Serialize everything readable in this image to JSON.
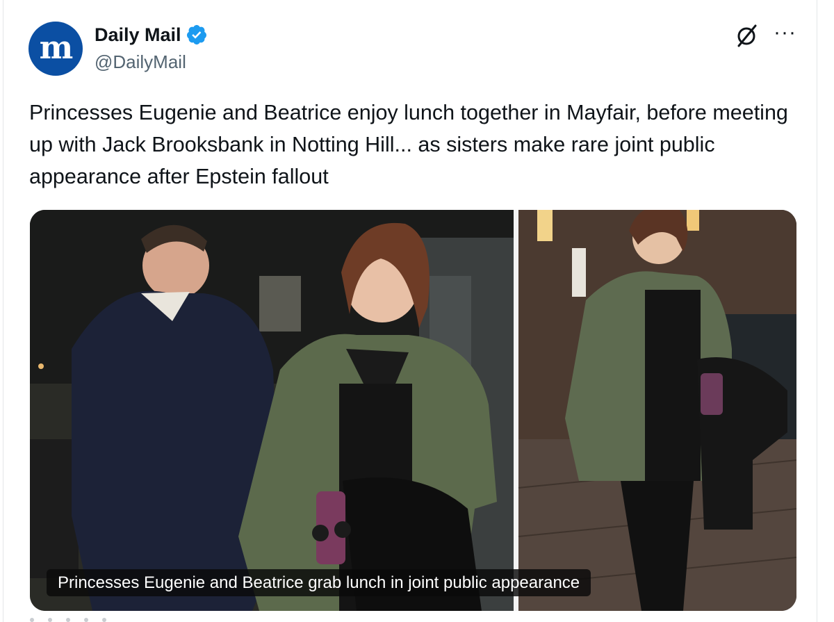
{
  "tweet": {
    "avatar": {
      "icon": "daily-mail-logo",
      "glyph": "m",
      "color": "#0b4fa3"
    },
    "author_name": "Daily Mail",
    "verified_icon": "verified-badge-icon",
    "verified_color": "#1d9bf0",
    "handle": "@DailyMail",
    "actions": {
      "grok_icon": "grok-icon",
      "more_icon": "more-options-icon",
      "more_glyph": "···"
    },
    "text": "Princesses Eugenie and Beatrice enjoy lunch together in Mayfair, before meeting up with Jack Brooksbank in Notting Hill... as sisters make rare joint public appearance after Epstein fallout",
    "media": {
      "photo_count": 2,
      "photos": [
        {
          "name": "photo-night-street",
          "subject": "two-people-walking"
        },
        {
          "name": "photo-restaurant-entrance",
          "subject": "woman-walking"
        }
      ],
      "caption": "Princesses Eugenie and Beatrice grab lunch in joint public appearance"
    }
  }
}
